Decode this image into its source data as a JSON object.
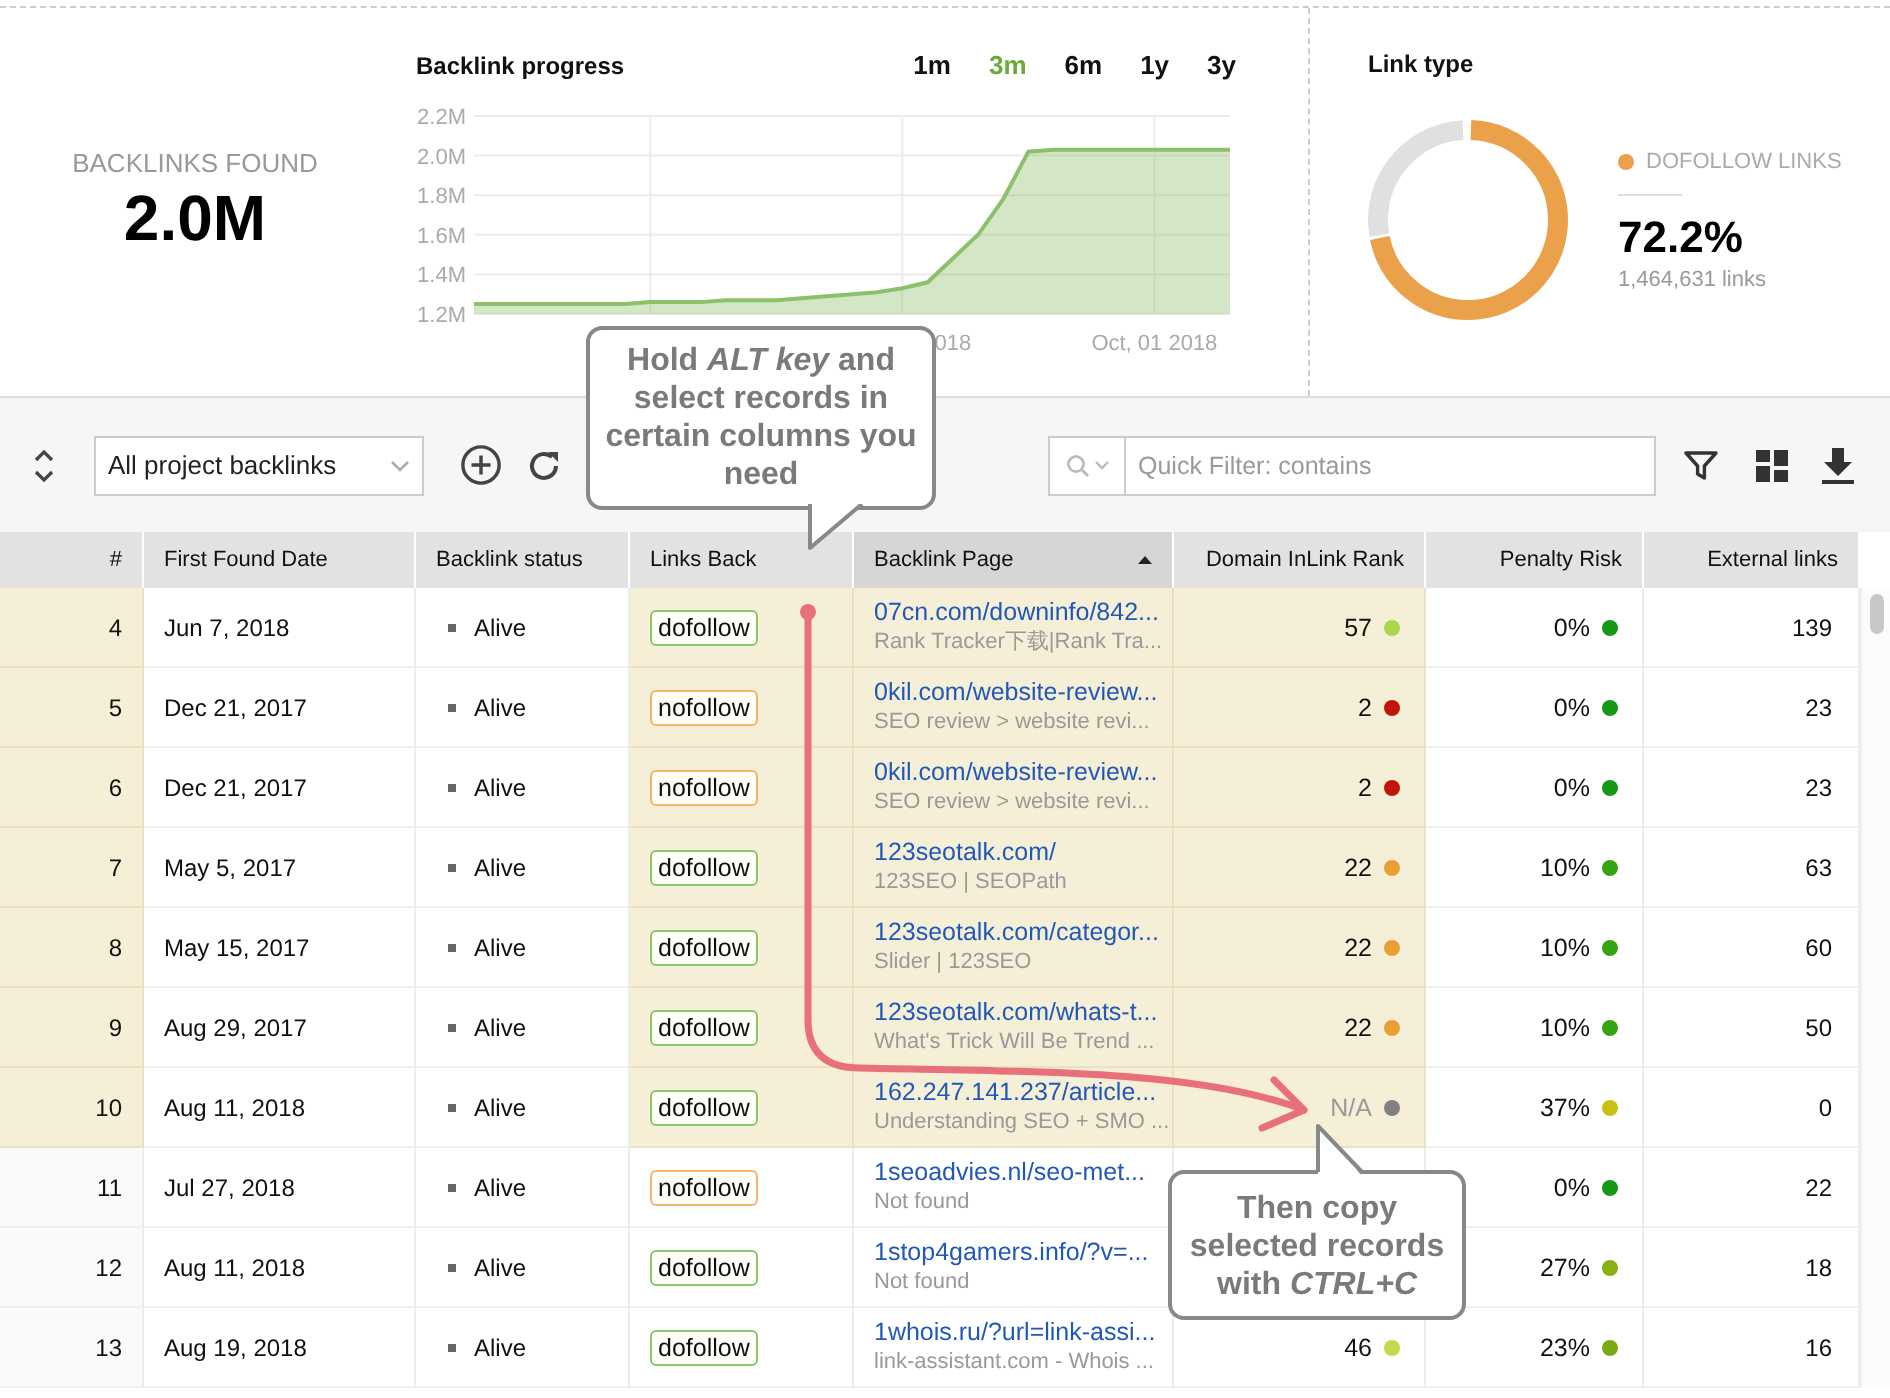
{
  "summary": {
    "label": "BACKLINKS FOUND",
    "value": "2.0M"
  },
  "progress": {
    "ranges": [
      {
        "label": "1m",
        "selected": false
      },
      {
        "label": "3m",
        "selected": true
      },
      {
        "label": "6m",
        "selected": false
      },
      {
        "label": "1y",
        "selected": false
      },
      {
        "label": "3y",
        "selected": false
      }
    ],
    "chart_data": {
      "type": "area",
      "title": "Backlink progress",
      "grid": true,
      "categories": [
        null,
        null,
        null,
        null,
        null,
        null,
        null,
        null,
        null,
        null,
        null,
        null,
        null,
        null,
        null,
        null,
        null,
        null,
        null,
        "018",
        null,
        null,
        null,
        null,
        null,
        null,
        null,
        "Oct, 01 2018",
        null,
        null,
        null
      ],
      "series": [
        {
          "color": "#8cc06b",
          "values": [
            1.25,
            1.25,
            1.25,
            1.25,
            1.25,
            1.25,
            1.25,
            1.26,
            1.26,
            1.26,
            1.27,
            1.27,
            1.27,
            1.28,
            1.29,
            1.3,
            1.31,
            1.33,
            1.36,
            1.48,
            1.6,
            1.78,
            2.02,
            2.03,
            2.03,
            2.03,
            2.03,
            2.03,
            2.03,
            2.03,
            2.03
          ]
        }
      ],
      "ylim": [
        1.2,
        2.2
      ],
      "yticks": [
        {
          "value": 1.2,
          "label": "1.2M"
        },
        {
          "value": 1.4,
          "label": "1.4M"
        },
        {
          "value": 1.6,
          "label": "1.6M"
        },
        {
          "value": 1.8,
          "label": "1.8M"
        },
        {
          "value": 2.0,
          "label": "2.0M"
        },
        {
          "value": 2.2,
          "label": "2.2M"
        }
      ]
    }
  },
  "link_type": {
    "title": "Link type",
    "legend": "DOFOLLOW LINKS",
    "level": 0.722,
    "percent": "72.2%",
    "count": "1,464,631 links"
  },
  "toolbar": {
    "filter_select": "All project backlinks",
    "search_placeholder": "Quick Filter: contains"
  },
  "table": {
    "columns": [
      {
        "label": "#",
        "selected": true,
        "sorted": false
      },
      {
        "label": "First Found Date",
        "selected": false,
        "sorted": false
      },
      {
        "label": "Backlink status",
        "selected": false,
        "sorted": false
      },
      {
        "label": "Links Back",
        "selected": true,
        "sorted": false
      },
      {
        "label": "Backlink Page",
        "selected": true,
        "sorted": true
      },
      {
        "label": "Domain InLink Rank",
        "selected": true,
        "sorted": false
      },
      {
        "label": "Penalty Risk",
        "selected": false,
        "sorted": false
      },
      {
        "label": "External links",
        "selected": false,
        "sorted": false
      }
    ],
    "rows": [
      {
        "num": "4",
        "date": "Jun 7, 2018",
        "status": "Alive",
        "links_back": {
          "label": "dofollow",
          "kind": "dofollow"
        },
        "url": "07cn.com/downinfo/842...",
        "page_title": "Rank Tracker下载|Rank Tra...",
        "rank": {
          "value": "57",
          "color": "#a8d94c",
          "muted": false
        },
        "penalty": {
          "value": "0%",
          "color": "#129a12"
        },
        "external": "139",
        "selected": true
      },
      {
        "num": "5",
        "date": "Dec 21, 2017",
        "status": "Alive",
        "links_back": {
          "label": "nofollow",
          "kind": "nofollow"
        },
        "url": "0kil.com/website-review...",
        "page_title": "SEO review > website revi...",
        "rank": {
          "value": "2",
          "color": "#c0150c",
          "muted": false
        },
        "penalty": {
          "value": "0%",
          "color": "#129a12"
        },
        "external": "23",
        "selected": true
      },
      {
        "num": "6",
        "date": "Dec 21, 2017",
        "status": "Alive",
        "links_back": {
          "label": "nofollow",
          "kind": "nofollow"
        },
        "url": "0kil.com/website-review...",
        "page_title": "SEO review > website revi...",
        "rank": {
          "value": "2",
          "color": "#c0150c",
          "muted": false
        },
        "penalty": {
          "value": "0%",
          "color": "#129a12"
        },
        "external": "23",
        "selected": true
      },
      {
        "num": "7",
        "date": "May 5, 2017",
        "status": "Alive",
        "links_back": {
          "label": "dofollow",
          "kind": "dofollow"
        },
        "url": "123seotalk.com/",
        "page_title": "123SEO | SEOPath",
        "rank": {
          "value": "22",
          "color": "#e8a030",
          "muted": false
        },
        "penalty": {
          "value": "10%",
          "color": "#35a512"
        },
        "external": "63",
        "selected": true
      },
      {
        "num": "8",
        "date": "May 15, 2017",
        "status": "Alive",
        "links_back": {
          "label": "dofollow",
          "kind": "dofollow"
        },
        "url": "123seotalk.com/categor...",
        "page_title": "Slider | 123SEO",
        "rank": {
          "value": "22",
          "color": "#e8a030",
          "muted": false
        },
        "penalty": {
          "value": "10%",
          "color": "#35a512"
        },
        "external": "60",
        "selected": true
      },
      {
        "num": "9",
        "date": "Aug 29, 2017",
        "status": "Alive",
        "links_back": {
          "label": "dofollow",
          "kind": "dofollow"
        },
        "url": "123seotalk.com/whats-t...",
        "page_title": "What's Trick Will Be Trend ...",
        "rank": {
          "value": "22",
          "color": "#e8a030",
          "muted": false
        },
        "penalty": {
          "value": "10%",
          "color": "#35a512"
        },
        "external": "50",
        "selected": true
      },
      {
        "num": "10",
        "date": "Aug 11, 2018",
        "status": "Alive",
        "links_back": {
          "label": "dofollow",
          "kind": "dofollow"
        },
        "url": "162.247.141.237/article...",
        "page_title": "Understanding SEO + SMO ...",
        "rank": {
          "value": "N/A",
          "color": "#808080",
          "muted": true
        },
        "penalty": {
          "value": "37%",
          "color": "#c8c012"
        },
        "external": "0",
        "selected": true
      },
      {
        "num": "11",
        "date": "Jul 27, 2018",
        "status": "Alive",
        "links_back": {
          "label": "nofollow",
          "kind": "nofollow"
        },
        "url": "1seoadvies.nl/seo-met...",
        "page_title": "Not found",
        "penalty": {
          "value": "0%",
          "color": "#129a12"
        },
        "external": "22",
        "selected": false
      },
      {
        "num": "12",
        "date": "Aug 11, 2018",
        "status": "Alive",
        "links_back": {
          "label": "dofollow",
          "kind": "dofollow"
        },
        "url": "1stop4gamers.info/?v=...",
        "page_title": "Not found",
        "penalty": {
          "value": "27%",
          "color": "#8ab012"
        },
        "external": "18",
        "selected": false
      },
      {
        "num": "13",
        "date": "Aug 19, 2018",
        "status": "Alive",
        "links_back": {
          "label": "dofollow",
          "kind": "dofollow"
        },
        "url": "1whois.ru/?url=link-assi...",
        "page_title": "link-assistant.com - Whois ...",
        "rank": {
          "value": "46",
          "color": "#c2da4c",
          "muted": false
        },
        "penalty": {
          "value": "23%",
          "color": "#7aaa12"
        },
        "external": "16",
        "selected": false
      }
    ]
  },
  "callouts": [
    {
      "text": "Hold *ALT key* and select records in certain columns you need"
    },
    {
      "text": "Then copy selected records with *CTRL+C*"
    }
  ]
}
